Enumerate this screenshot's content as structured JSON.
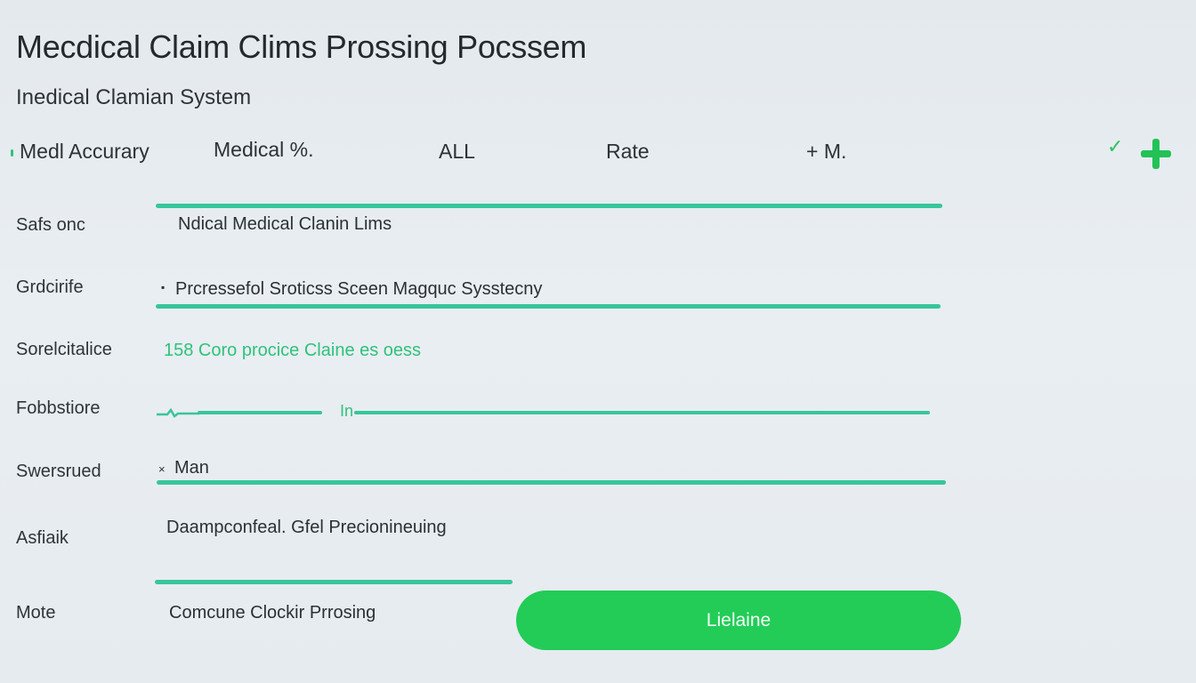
{
  "header": {
    "title": "Mecdical Claim Clims Prossing Pocssem",
    "subtitle": "Inedical Clamian System"
  },
  "tabs": [
    {
      "label": "Medl Accurary"
    },
    {
      "label": "Medical %."
    },
    {
      "label": "ALL"
    },
    {
      "label": "Rate"
    },
    {
      "label": "+ M."
    }
  ],
  "header_actions": {
    "check_glyph": "✓",
    "check_icon": "check-icon",
    "add_icon": "plus-icon"
  },
  "form": {
    "rows": [
      {
        "label": "Safs onc",
        "value": "Ndical Medical Clanin Lims"
      },
      {
        "label": "Grdcirife",
        "prefix": "▪",
        "value": "Prcressefol Sroticss Sceen Magquc Sysstecny"
      },
      {
        "label": "Sorelcitalice",
        "value": "158 Coro procice Claine es oess"
      },
      {
        "label": "Fobbstiore",
        "value": "In"
      },
      {
        "label": "Swersrued",
        "prefix": "×",
        "value": "Man"
      },
      {
        "label": "Asfiaik",
        "value": "Daampconfeal. Gfel Precionineuing"
      },
      {
        "label": "Mote",
        "value": "Comcune Clockir Prrosing"
      }
    ]
  },
  "submit": {
    "label": "Lielaine"
  },
  "colors": {
    "accent_green": "#22cc57",
    "underline_teal": "#37c69a",
    "text_green": "#2fc27a",
    "background": "#e6ebf0"
  }
}
